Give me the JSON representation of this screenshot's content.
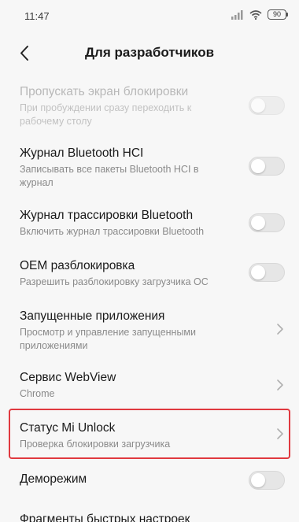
{
  "status_bar": {
    "time": "11:47",
    "battery": "90"
  },
  "header": {
    "title": "Для разработчиков",
    "back_icon": "chevron-left-icon"
  },
  "items": [
    {
      "title": "Пропускать экран блокировки",
      "subtitle_lines": [
        "При пробуждении сразу переходить к",
        "рабочему столу"
      ],
      "control": "toggle",
      "enabled": false
    },
    {
      "title": "Журнал Bluetooth HCI",
      "subtitle_lines": [
        "Записывать все пакеты Bluetooth HCI в",
        "журнал"
      ],
      "control": "toggle",
      "enabled": true
    },
    {
      "title": "Журнал трассировки Bluetooth",
      "subtitle_lines": [
        "Включить журнал трассировки Bluetooth"
      ],
      "control": "toggle",
      "enabled": true
    },
    {
      "title": "OEM разблокировка",
      "subtitle_lines": [
        "Разрешить разблокировку загрузчика ОС"
      ],
      "control": "toggle",
      "enabled": true
    },
    {
      "title": "Запущенные приложения",
      "subtitle_lines": [
        "Просмотр и управление запущенными",
        "приложениями"
      ],
      "control": "chevron",
      "enabled": true
    },
    {
      "title": "Сервис WebView",
      "subtitle_lines": [
        "Chrome"
      ],
      "control": "chevron",
      "enabled": true
    },
    {
      "title": "Статус Mi Unlock",
      "subtitle_lines": [
        "Проверка блокировки загрузчика"
      ],
      "control": "chevron",
      "enabled": true
    },
    {
      "title": "Деморежим",
      "subtitle_lines": [],
      "control": "toggle",
      "enabled": true
    },
    {
      "title": "Фрагменты быстрых настроек",
      "subtitle_lines": [],
      "control": "none",
      "enabled": true
    }
  ],
  "colors": {
    "highlight": "#e0393f",
    "background": "#f7f7f7"
  }
}
